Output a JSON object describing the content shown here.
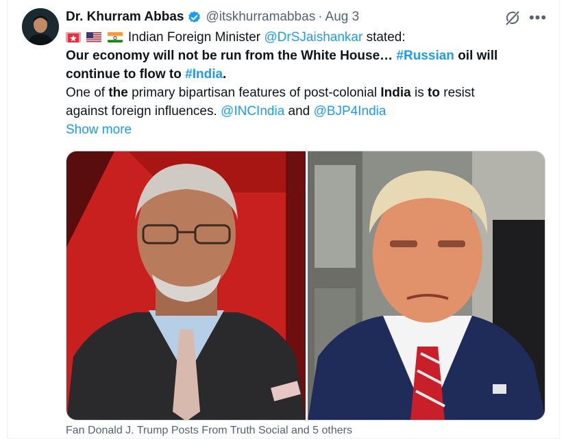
{
  "tweet": {
    "author_name": "Dr. Khurram Abbas",
    "handle": "@itskhurramabbas",
    "separator": "·",
    "date": "Aug 3",
    "more_glyph": "•••",
    "line1_prefix": "Indian Foreign Minister",
    "line1_mention": "@DrSJaishankar",
    "line1_suffix": "stated:",
    "line2_bold": "Our economy will not be run from the White House…",
    "line2_hashtag": "#Russian",
    "line2_bold_end": "oil will",
    "line3_bold": "continue to flow to",
    "line3_hashtag": "#India",
    "line3_end": ".",
    "line4_a": "One of",
    "line4_b": "the",
    "line4_c": "primary bipartisan features of post-colonial",
    "line4_d": "India",
    "line4_e": "is",
    "line4_f": "to",
    "line4_g": "resist",
    "line5_a": "against foreign influences.",
    "line5_mention1": "@INCIndia",
    "line5_and": "and",
    "line5_mention2": "@BJP4India",
    "show_more": "Show more",
    "social_context": "Fan Donald J. Trump Posts From Truth Social and 5 others"
  },
  "icons": {
    "verified": "verified-badge-icon",
    "grok": "grok-icon",
    "more": "more-icon",
    "flags": [
      "badge-emoji-icon",
      "us-flag-icon",
      "india-flag-icon"
    ]
  },
  "colors": {
    "link": "#1d9bf0",
    "secondary_text": "#536471",
    "primary_text": "#0f1419",
    "left_photo_bg": "#c8201e",
    "right_photo_bg": "#8c8f88"
  }
}
